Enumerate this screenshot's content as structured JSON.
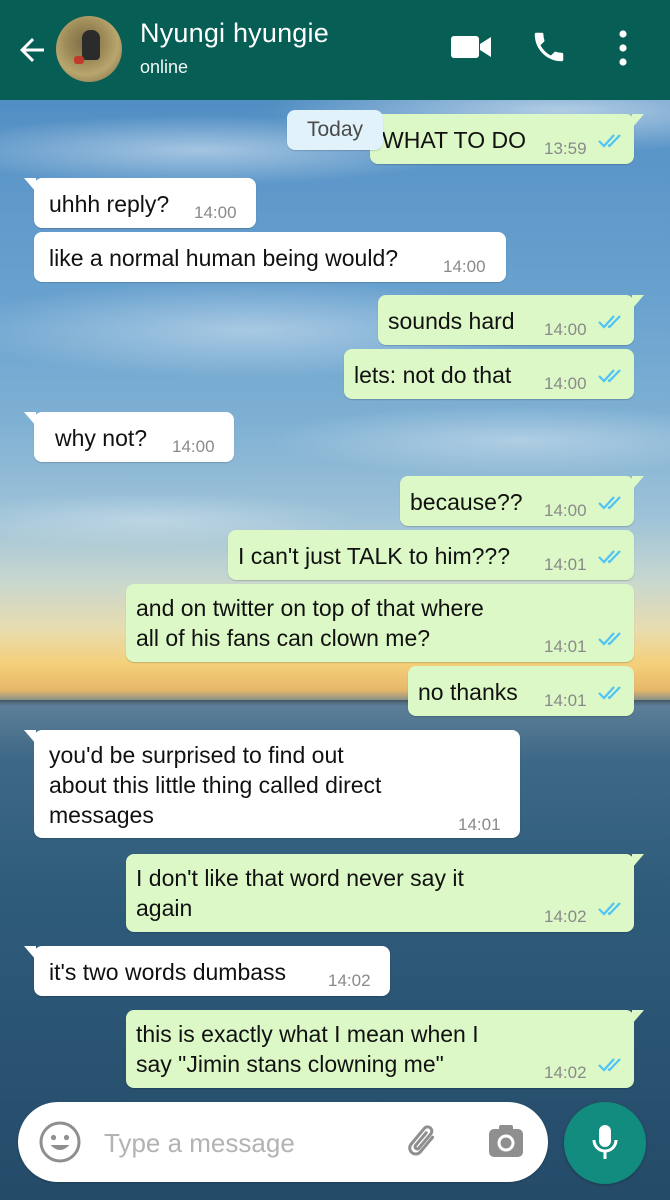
{
  "header": {
    "contact_name": "Nyungi hyungie",
    "status": "online",
    "icons": [
      "back-arrow-icon",
      "avatar",
      "video-call-icon",
      "phone-call-icon",
      "more-options-icon"
    ]
  },
  "date_chip": "Today",
  "messages": [
    {
      "dir": "out",
      "text": "WHAT TO DO",
      "time": "13:59",
      "read": true
    },
    {
      "dir": "in",
      "text": "uhhh reply?",
      "time": "14:00"
    },
    {
      "dir": "in",
      "text": "like a normal human being would?",
      "time": "14:00"
    },
    {
      "dir": "out",
      "text": "sounds hard",
      "time": "14:00",
      "read": true
    },
    {
      "dir": "out",
      "text": "lets: not do that",
      "time": "14:00",
      "read": true
    },
    {
      "dir": "in",
      "text": "why not?",
      "time": "14:00"
    },
    {
      "dir": "out",
      "text": "because??",
      "time": "14:00",
      "read": true
    },
    {
      "dir": "out",
      "text": "I can't just TALK to him???",
      "time": "14:01",
      "read": true
    },
    {
      "dir": "out",
      "text": "and on twitter on top of that where\nall of his fans can clown me?",
      "time": "14:01",
      "read": true
    },
    {
      "dir": "out",
      "text": "no thanks",
      "time": "14:01",
      "read": true
    },
    {
      "dir": "in",
      "text": "you'd be surprised to find out\nabout this little thing called direct\nmessages",
      "time": "14:01"
    },
    {
      "dir": "out",
      "text": "I don't like that word never say it\nagain",
      "time": "14:02",
      "read": true
    },
    {
      "dir": "in",
      "text": "it's two words dumbass",
      "time": "14:02"
    },
    {
      "dir": "out",
      "text": "this is exactly what I mean when I\nsay \"Jimin stans clowning me\"",
      "time": "14:02",
      "read": true
    }
  ],
  "composer": {
    "placeholder": "Type a message",
    "value": ""
  },
  "colors": {
    "header": "#075e54",
    "outgoing_bubble": "#dcf8c6",
    "incoming_bubble": "#ffffff",
    "read_tick": "#4fc3f7",
    "mic_button": "#128c7e"
  }
}
